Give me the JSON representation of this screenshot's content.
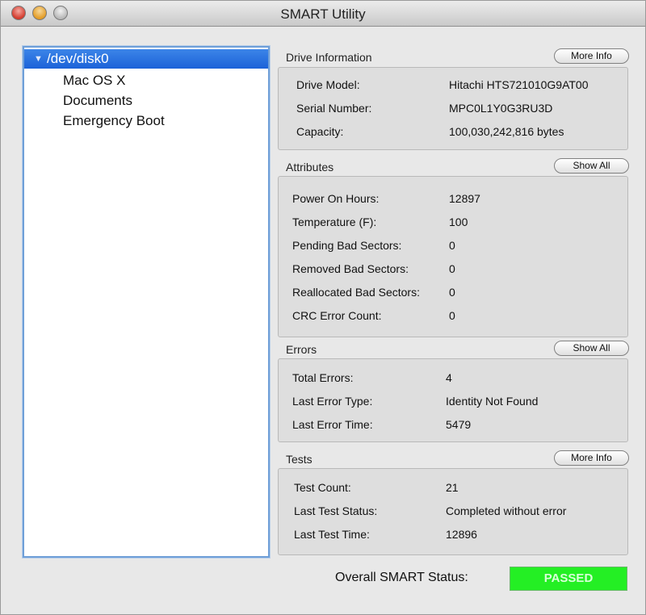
{
  "window": {
    "title": "SMART Utility"
  },
  "sidebar": {
    "root": "/dev/disk0",
    "children": [
      "Mac OS X",
      "Documents",
      "Emergency Boot"
    ]
  },
  "drive_info": {
    "title": "Drive Information",
    "button": "More Info",
    "rows": [
      {
        "label": "Drive Model:",
        "value": "Hitachi HTS721010G9AT00"
      },
      {
        "label": "Serial Number:",
        "value": "MPC0L1Y0G3RU3D"
      },
      {
        "label": "Capacity:",
        "value": "100,030,242,816 bytes"
      }
    ]
  },
  "attributes": {
    "title": "Attributes",
    "button": "Show All",
    "rows": [
      {
        "label": "Power On Hours:",
        "value": "12897"
      },
      {
        "label": "Temperature (F):",
        "value": "100"
      },
      {
        "label": "Pending Bad Sectors:",
        "value": "0"
      },
      {
        "label": "Removed Bad Sectors:",
        "value": "0"
      },
      {
        "label": "Reallocated Bad Sectors:",
        "value": "0"
      },
      {
        "label": "CRC Error Count:",
        "value": "0"
      }
    ]
  },
  "errors": {
    "title": "Errors",
    "button": "Show All",
    "rows": [
      {
        "label": "Total Errors:",
        "value": "4"
      },
      {
        "label": "Last Error Type:",
        "value": "Identity Not Found"
      },
      {
        "label": "Last Error Time:",
        "value": "5479"
      }
    ]
  },
  "tests": {
    "title": "Tests",
    "button": "More Info",
    "rows": [
      {
        "label": "Test Count:",
        "value": "21"
      },
      {
        "label": "Last Test Status:",
        "value": "Completed without error"
      },
      {
        "label": "Last Test Time:",
        "value": "12896"
      }
    ]
  },
  "overall": {
    "label": "Overall SMART Status:",
    "value": "PASSED",
    "color": "#24ef24"
  }
}
